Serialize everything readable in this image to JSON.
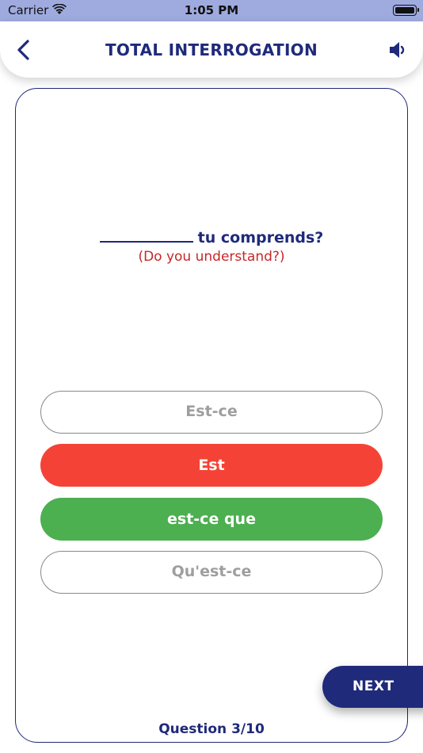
{
  "status_bar": {
    "carrier": "Carrier",
    "time": "1:05 PM"
  },
  "header": {
    "title": "TOTAL INTERROGATION"
  },
  "question": {
    "text": "tu comprends?",
    "translation": "(Do you understand?)"
  },
  "options": [
    {
      "label": "Est-ce",
      "state": "neutral"
    },
    {
      "label": "Est",
      "state": "wrong"
    },
    {
      "label": "est-ce que",
      "state": "correct"
    },
    {
      "label": "Qu'est-ce",
      "state": "neutral"
    }
  ],
  "progress": {
    "label": "Question 3/10"
  },
  "next_button": {
    "label": "NEXT"
  },
  "colors": {
    "primary": "#1f2a7a",
    "status_bar": "#9fabdf",
    "wrong": "#f44336",
    "correct": "#4caf50",
    "translation": "#c62828"
  }
}
